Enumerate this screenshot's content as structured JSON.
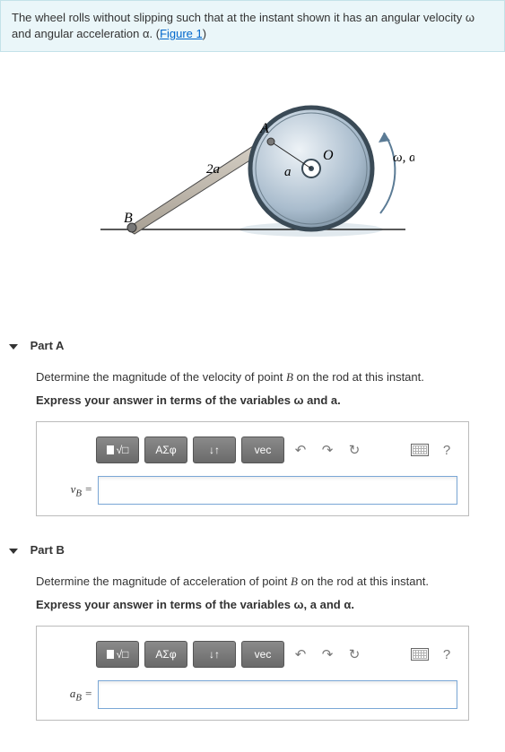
{
  "problem": {
    "text_before_link": "The wheel rolls without slipping such that at the instant shown it has an angular velocity ω and angular acceleration α. (",
    "link_text": "Figure 1",
    "text_after_link": ")"
  },
  "figure": {
    "labels": {
      "A": "A",
      "B": "B",
      "O": "O",
      "two_a": "2a",
      "a": "a",
      "omega_alpha": "ω, α"
    }
  },
  "parts": [
    {
      "title": "Part A",
      "prompt_pre": "Determine the magnitude of the velocity of point ",
      "prompt_point": "B",
      "prompt_post": " on the rod at this instant.",
      "hint": "Express your answer in terms of the variables ω and a.",
      "var_label": "v_B ="
    },
    {
      "title": "Part B",
      "prompt_pre": "Determine the magnitude of acceleration of point ",
      "prompt_point": "B",
      "prompt_post": " on the rod at this instant.",
      "hint": "Express your answer in terms of the variables ω, a and α.",
      "var_label": "a_B ="
    }
  ],
  "toolbar": {
    "template": "□",
    "fraction": "√□",
    "greek": "ΑΣφ",
    "subsup": "↓↑",
    "vec": "vec",
    "undo": "↶",
    "redo": "↷",
    "reset": "↻",
    "help": "?"
  }
}
